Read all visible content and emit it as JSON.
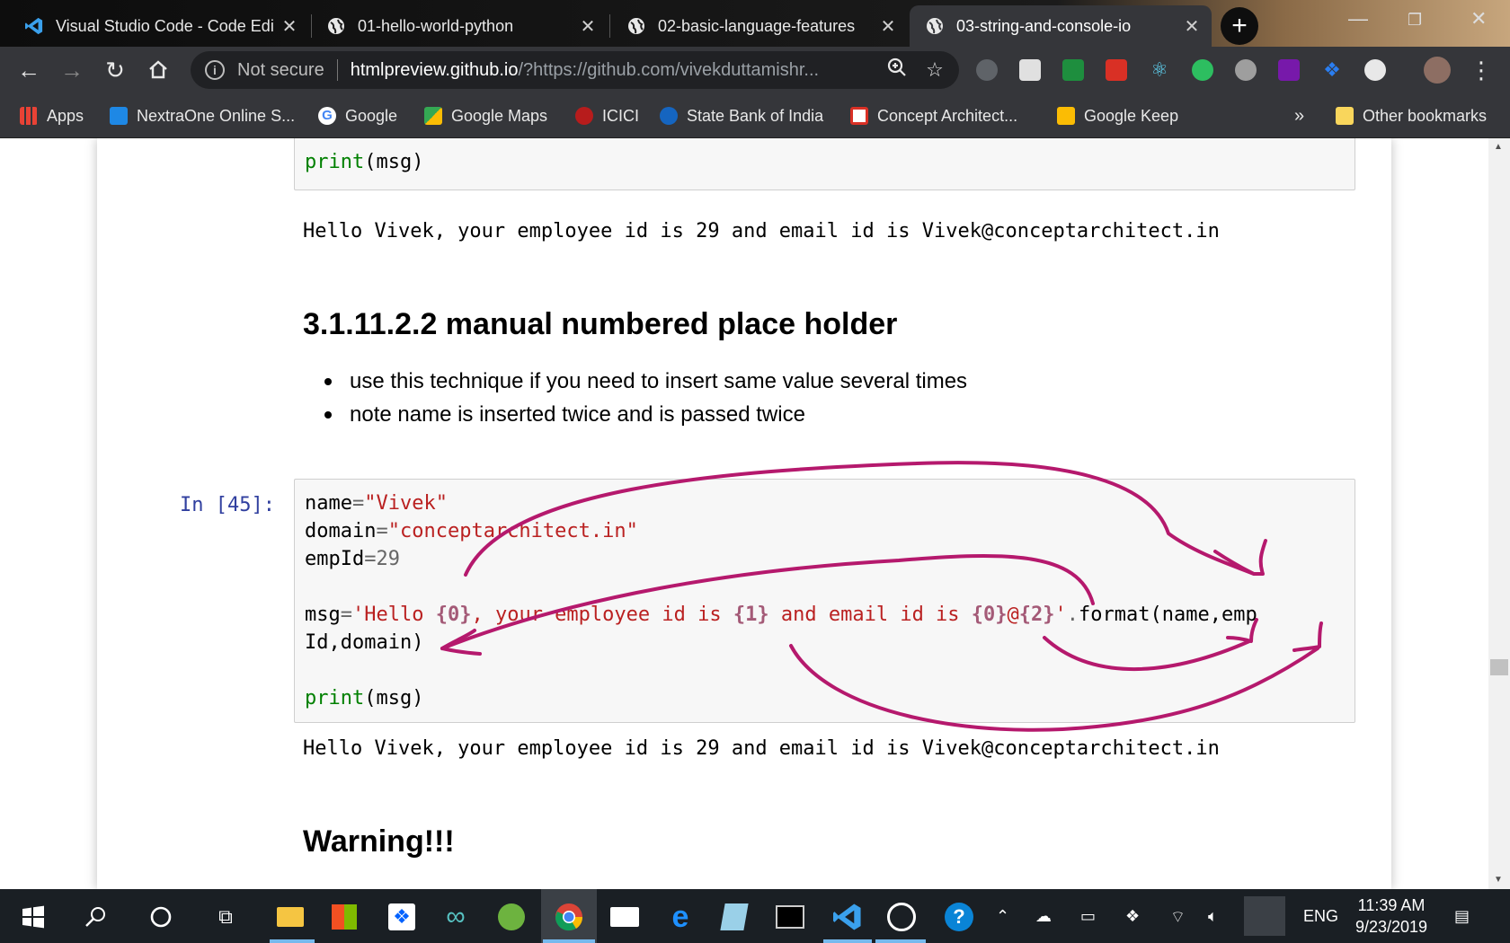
{
  "tabs": [
    {
      "title": "Visual Studio Code - Code Edi",
      "icon": "vscode-icon"
    },
    {
      "title": "01-hello-world-python",
      "icon": "globe-icon"
    },
    {
      "title": "02-basic-language-features",
      "icon": "globe-icon"
    },
    {
      "title": "03-string-and-console-io",
      "icon": "globe-icon"
    }
  ],
  "omnibox": {
    "security": "Not secure",
    "url_host": "htmlpreview.github.io",
    "url_rest": "/?https://github.com/vivekduttamishr..."
  },
  "bookmarks": [
    {
      "label": "Apps",
      "color": "#e94235"
    },
    {
      "label": "NextraOne Online S...",
      "color": "#1e88e5"
    },
    {
      "label": "Google",
      "color": "#4285f4"
    },
    {
      "label": "Google Maps",
      "color": "#34a853"
    },
    {
      "label": "ICICI",
      "color": "#b71c1c"
    },
    {
      "label": "State Bank of India",
      "color": "#1565c0"
    },
    {
      "label": "Concept Architect...",
      "color": "#d93025"
    },
    {
      "label": "Google Keep",
      "color": "#fbbc04"
    }
  ],
  "bookmarks_overflow": "»",
  "other_bookmarks": "Other bookmarks",
  "notebook": {
    "top_code_last_line": "print(msg)",
    "top_output": "Hello Vivek, your employee id is 29 and email id is Vivek@conceptarchitect.in",
    "heading": "3.1.11.2.2 manual numbered place holder",
    "bullets": [
      "use this technique if you need to insert same value several times",
      "note name is inserted twice and is passed twice"
    ],
    "prompt": "In [45]:",
    "output": "Hello Vivek, your employee id is 29 and email id is Vivek@conceptarchitect.in",
    "warning": "Warning!!!"
  },
  "taskbar": {
    "language": "ENG",
    "time": "11:39 AM",
    "date": "9/23/2019"
  },
  "annotation_color": "#b5196d"
}
